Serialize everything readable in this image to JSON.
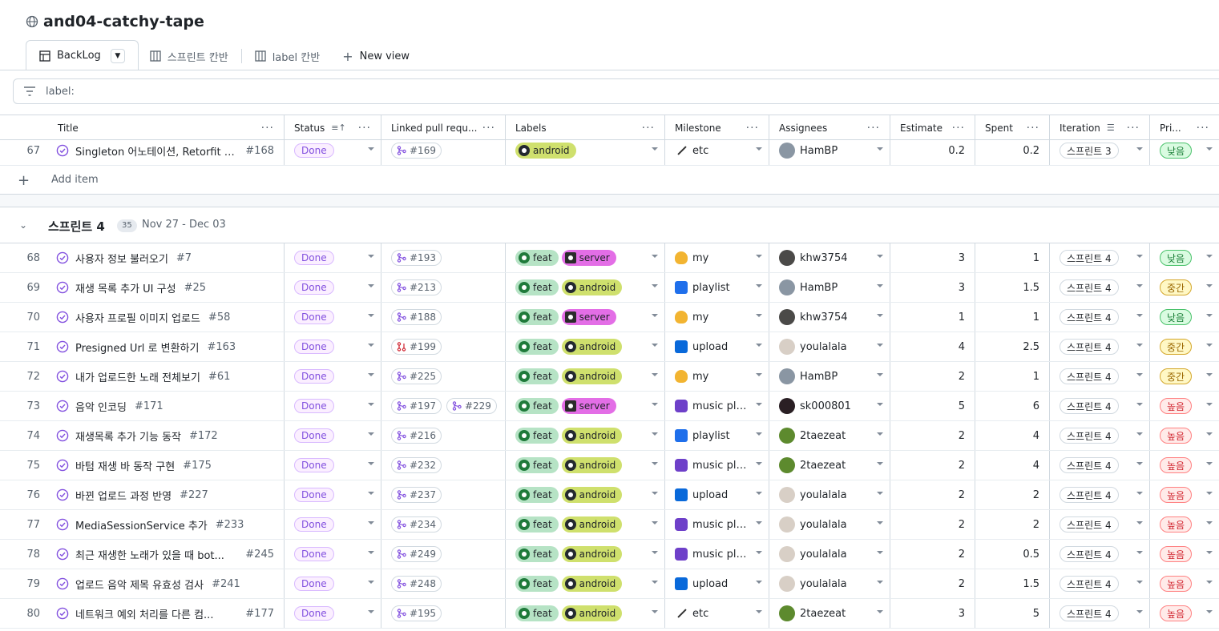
{
  "project": {
    "title": "and04-catchy-tape"
  },
  "tabs": [
    {
      "label": "BackLog",
      "active": true
    },
    {
      "label": "스프린트 칸반",
      "active": false
    },
    {
      "label": "label 칸반",
      "active": false
    },
    {
      "label": "New view",
      "active": false
    }
  ],
  "filter": {
    "text": "label:"
  },
  "columns": {
    "title": "Title",
    "status": "Status",
    "linked_prs": "Linked pull requ...",
    "labels": "Labels",
    "milestone": "Milestone",
    "assignees": "Assignees",
    "estimate": "Estimate",
    "spent": "Spent",
    "iteration": "Iteration",
    "priority": "Pri..."
  },
  "top_row": {
    "num": "67",
    "title": "Singleton 어노테이션, Retorfit S...",
    "issue": "#168",
    "status": "Done",
    "prs": [
      "#169"
    ],
    "labels": [
      "android"
    ],
    "milestone": "etc",
    "milestone_icon": "wrench-icon",
    "assignee": "HamBP",
    "estimate": "0.2",
    "spent": "0.2",
    "iteration": "스프린트 3",
    "priority": "낮음"
  },
  "add_item": {
    "label": "Add item"
  },
  "group": {
    "title": "스프린트 4",
    "count": "35",
    "dates": "Nov 27 - Dec 03"
  },
  "rows": [
    {
      "num": "68",
      "title": "사용자 정보 불러오기",
      "issue": "#7",
      "status": "Done",
      "prs": [
        "#193"
      ],
      "labels": [
        "feat",
        "server"
      ],
      "milestone": "my",
      "milestone_icon": "my",
      "assignee": "khw3754",
      "avatar": "khw",
      "estimate": "3",
      "spent": "1",
      "iteration": "스프린트 4",
      "priority": "낮음",
      "prio": "low"
    },
    {
      "num": "69",
      "title": "재생 목록 추가 UI 구성",
      "issue": "#25",
      "status": "Done",
      "prs": [
        "#213"
      ],
      "labels": [
        "feat",
        "android"
      ],
      "milestone": "playlist",
      "milestone_icon": "playlist",
      "assignee": "HamBP",
      "avatar": "hambp",
      "estimate": "3",
      "spent": "1.5",
      "iteration": "스프린트 4",
      "priority": "중간",
      "prio": "mid"
    },
    {
      "num": "70",
      "title": "사용자 프로필 이미지 업로드",
      "issue": "#58",
      "status": "Done",
      "prs": [
        "#188"
      ],
      "labels": [
        "feat",
        "server"
      ],
      "milestone": "my",
      "milestone_icon": "my",
      "assignee": "khw3754",
      "avatar": "khw",
      "estimate": "1",
      "spent": "1",
      "iteration": "스프린트 4",
      "priority": "낮음",
      "prio": "low"
    },
    {
      "num": "71",
      "title": "Presigned Url 로 변환하기",
      "issue": "#163",
      "status": "Done",
      "prs": [
        "#199"
      ],
      "labels": [
        "feat",
        "android"
      ],
      "milestone": "upload",
      "milestone_icon": "upload",
      "assignee": "youlalala",
      "avatar": "you",
      "estimate": "4",
      "spent": "2.5",
      "iteration": "스프린트 4",
      "priority": "중간",
      "prio": "mid"
    },
    {
      "num": "72",
      "title": "내가 업로드한 노래 전체보기",
      "issue": "#61",
      "status": "Done",
      "prs": [
        "#225"
      ],
      "labels": [
        "feat",
        "android"
      ],
      "milestone": "my",
      "milestone_icon": "my",
      "assignee": "HamBP",
      "avatar": "hambp",
      "estimate": "2",
      "spent": "1",
      "iteration": "스프린트 4",
      "priority": "중간",
      "prio": "mid"
    },
    {
      "num": "73",
      "title": "음악 인코딩",
      "issue": "#171",
      "status": "Done",
      "prs": [
        "#197",
        "#229"
      ],
      "labels": [
        "feat",
        "server"
      ],
      "milestone": "music pla...",
      "milestone_icon": "music",
      "assignee": "sk000801",
      "avatar": "sk",
      "estimate": "5",
      "spent": "6",
      "iteration": "스프린트 4",
      "priority": "높음",
      "prio": "high"
    },
    {
      "num": "74",
      "title": "재생목록 추가 기능 동작",
      "issue": "#172",
      "status": "Done",
      "prs": [
        "#216"
      ],
      "labels": [
        "feat",
        "android"
      ],
      "milestone": "playlist",
      "milestone_icon": "playlist",
      "assignee": "2taezeat",
      "avatar": "2t",
      "estimate": "2",
      "spent": "4",
      "iteration": "스프린트 4",
      "priority": "높음",
      "prio": "high"
    },
    {
      "num": "75",
      "title": "바텀 재생 바 동작 구현",
      "issue": "#175",
      "status": "Done",
      "prs": [
        "#232"
      ],
      "labels": [
        "feat",
        "android"
      ],
      "milestone": "music pla...",
      "milestone_icon": "music",
      "assignee": "2taezeat",
      "avatar": "2t",
      "estimate": "2",
      "spent": "4",
      "iteration": "스프린트 4",
      "priority": "높음",
      "prio": "high"
    },
    {
      "num": "76",
      "title": "바뀐 업로드 과정 반영",
      "issue": "#227",
      "status": "Done",
      "prs": [
        "#237"
      ],
      "labels": [
        "feat",
        "android"
      ],
      "milestone": "upload",
      "milestone_icon": "upload",
      "assignee": "youlalala",
      "avatar": "you",
      "estimate": "2",
      "spent": "2",
      "iteration": "스프린트 4",
      "priority": "높음",
      "prio": "high"
    },
    {
      "num": "77",
      "title": "MediaSessionService 추가",
      "issue": "#233",
      "status": "Done",
      "prs": [
        "#234"
      ],
      "labels": [
        "feat",
        "android"
      ],
      "milestone": "music pla...",
      "milestone_icon": "music",
      "assignee": "youlalala",
      "avatar": "you",
      "estimate": "2",
      "spent": "2",
      "iteration": "스프린트 4",
      "priority": "높음",
      "prio": "high"
    },
    {
      "num": "78",
      "title": "최근 재생한 노래가 있을 때 bot...",
      "issue": "#245",
      "status": "Done",
      "prs": [
        "#249"
      ],
      "labels": [
        "feat",
        "android"
      ],
      "milestone": "music pla...",
      "milestone_icon": "music",
      "assignee": "youlalala",
      "avatar": "you",
      "estimate": "2",
      "spent": "0.5",
      "iteration": "스프린트 4",
      "priority": "높음",
      "prio": "high"
    },
    {
      "num": "79",
      "title": "업로드 음악 제목 유효성 검사",
      "issue": "#241",
      "status": "Done",
      "prs": [
        "#248"
      ],
      "labels": [
        "feat",
        "android"
      ],
      "milestone": "upload",
      "milestone_icon": "upload",
      "assignee": "youlalala",
      "avatar": "you",
      "estimate": "2",
      "spent": "1.5",
      "iteration": "스프린트 4",
      "priority": "높음",
      "prio": "high"
    },
    {
      "num": "80",
      "title": "네트워크 예외 처리를 다른 컴...",
      "issue": "#177",
      "status": "Done",
      "prs": [
        "#195"
      ],
      "labels": [
        "feat",
        "android"
      ],
      "milestone": "etc",
      "milestone_icon": "etc",
      "assignee": "2taezeat",
      "avatar": "2t",
      "estimate": "3",
      "spent": "5",
      "iteration": "스프린트 4",
      "priority": "높음",
      "prio": "high"
    }
  ]
}
